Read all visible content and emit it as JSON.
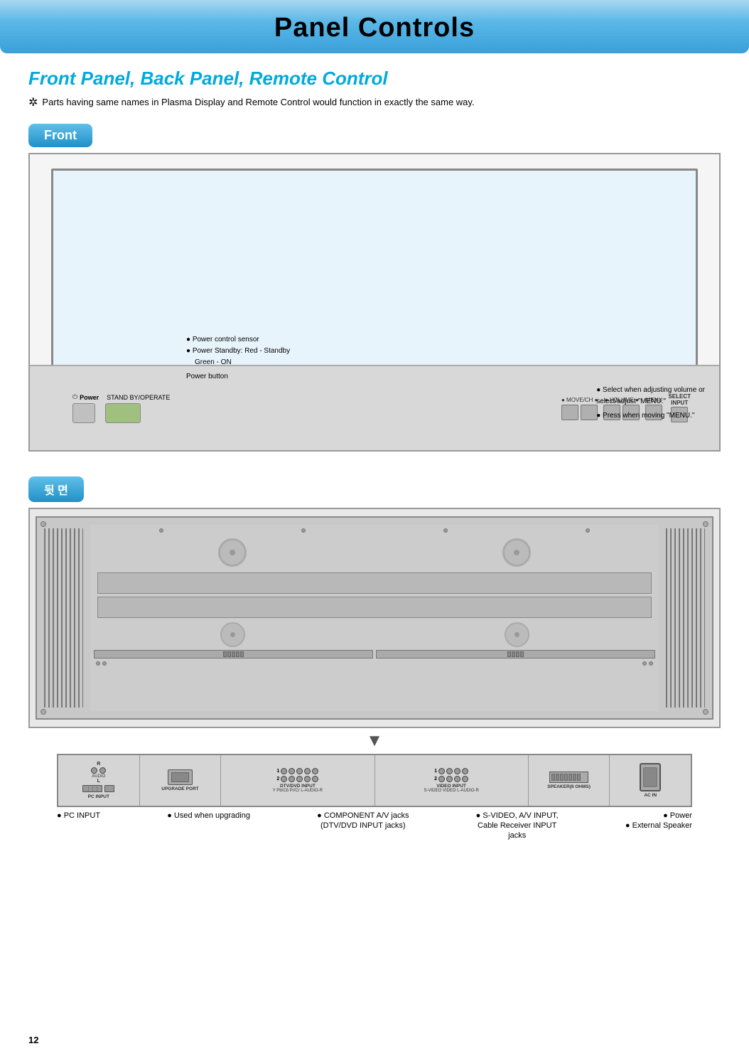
{
  "header": {
    "title": "Panel Controls"
  },
  "section": {
    "heading": "Front Panel, Back Panel, Remote Control",
    "note": "Parts having same names in Plasma Display and Remote Control would function in exactly the same way."
  },
  "front_panel": {
    "badge": "Front",
    "controls": {
      "power_label": "Power",
      "standby_label": "STAND BY/OPERATE",
      "move_ch": "● MOVE/CH ●",
      "volume": "● VOLUME ●",
      "menu": "MENU",
      "select": "SELECT\nINPUT"
    },
    "annotations": {
      "sensor": "● Power control sensor",
      "standby": "● Power Standby: Red - Standby\nGreen - ON",
      "power_btn": "Power button",
      "select_note": "● Select when adjusting volume or\nselect/adjust \"MENU.\"",
      "menu_note": "● Press when moving \"MENU.\""
    }
  },
  "back_panel": {
    "badge": "뒷 면"
  },
  "connector_strip": {
    "sections": [
      {
        "label": "PC INPUT",
        "sub": "R AUDIO L"
      },
      {
        "label": "UPGRADE PORT",
        "sub": ""
      },
      {
        "label": "DTV/DVD INPUT",
        "sub": "Y  Pb/Cb  Pr/Cr  L-AUDIO-R",
        "rows": [
          "1",
          "2"
        ]
      },
      {
        "label": "VIDEO INPUT",
        "sub": "S-VIDEO  VIDEO  L-AUDIO-R",
        "rows": [
          "1",
          "2"
        ]
      },
      {
        "label": "SPEAKER(8 OHMS)",
        "sub": ""
      },
      {
        "label": "AC IN",
        "sub": ""
      }
    ]
  },
  "bottom_labels": {
    "pc_input": "● PC INPUT",
    "upgrade": "● Used when upgrading",
    "component": "● COMPONENT A/V jacks\n(DTV/DVD INPUT jacks)",
    "svideo": "● S-VIDEO, A/V INPUT,\nCable Receiver INPUT\njacks",
    "power": "● Power",
    "speaker": "● External Speaker"
  },
  "page_number": "12"
}
